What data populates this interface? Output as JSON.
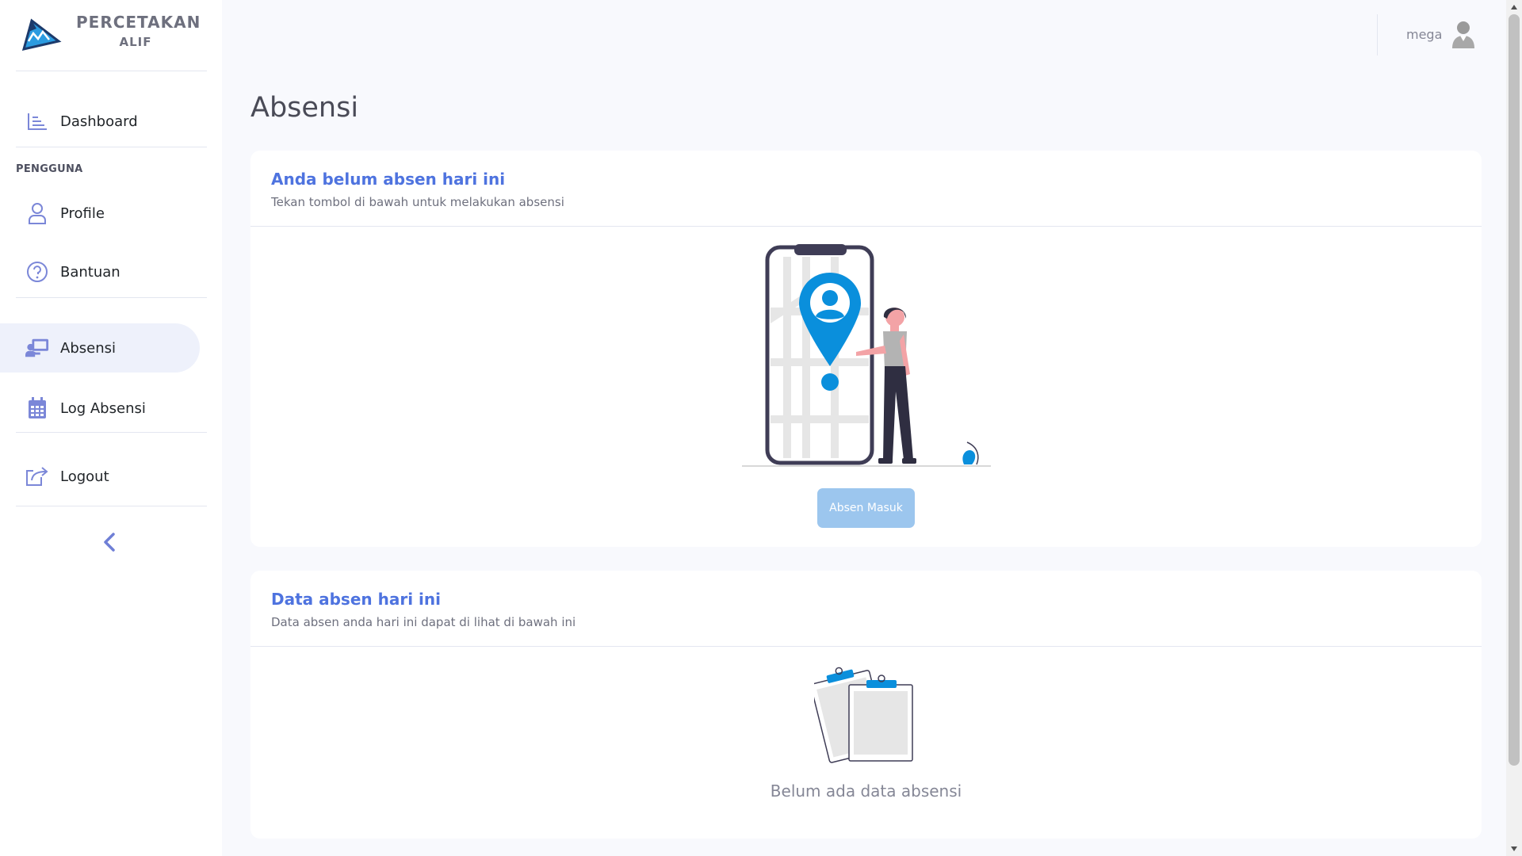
{
  "brand": {
    "line1": "PERCETAKAN",
    "line2": "ALIF",
    "logo_icon": "mountain-triangle-logo"
  },
  "sidebar": {
    "items": [
      {
        "label": "Dashboard",
        "icon": "chart-line-icon"
      },
      {
        "label": "Profile",
        "icon": "user-icon"
      },
      {
        "label": "Bantuan",
        "icon": "question-circle-icon"
      },
      {
        "label": "Absensi",
        "icon": "chalkboard-teacher-icon",
        "active": true
      },
      {
        "label": "Log Absensi",
        "icon": "calendar-icon"
      },
      {
        "label": "Logout",
        "icon": "share-exit-icon"
      }
    ],
    "section_heading": "PENGGUNA",
    "collapse_icon": "chevron-left-icon"
  },
  "topbar": {
    "user_name": "mega",
    "avatar_icon": "user-avatar-icon"
  },
  "page": {
    "title": "Absensi"
  },
  "card_absen": {
    "title": "Anda belum absen hari ini",
    "subtitle": "Tekan tombol di bawah untuk melakukan absensi",
    "button_label": "Absen Masuk",
    "illustration": "location-map-illustration"
  },
  "card_data": {
    "title": "Data absen hari ini",
    "subtitle": "Data absen anda hari ini dapat di lihat di bawah ini",
    "empty_text": "Belum ada data absensi",
    "illustration": "clipboards-illustration"
  },
  "colors": {
    "accent": "#4e73df",
    "icon": "#7b87d8",
    "button": "#9cc6ee",
    "illustration_blue": "#0a8fdc",
    "illustration_dark": "#3f3d56"
  }
}
